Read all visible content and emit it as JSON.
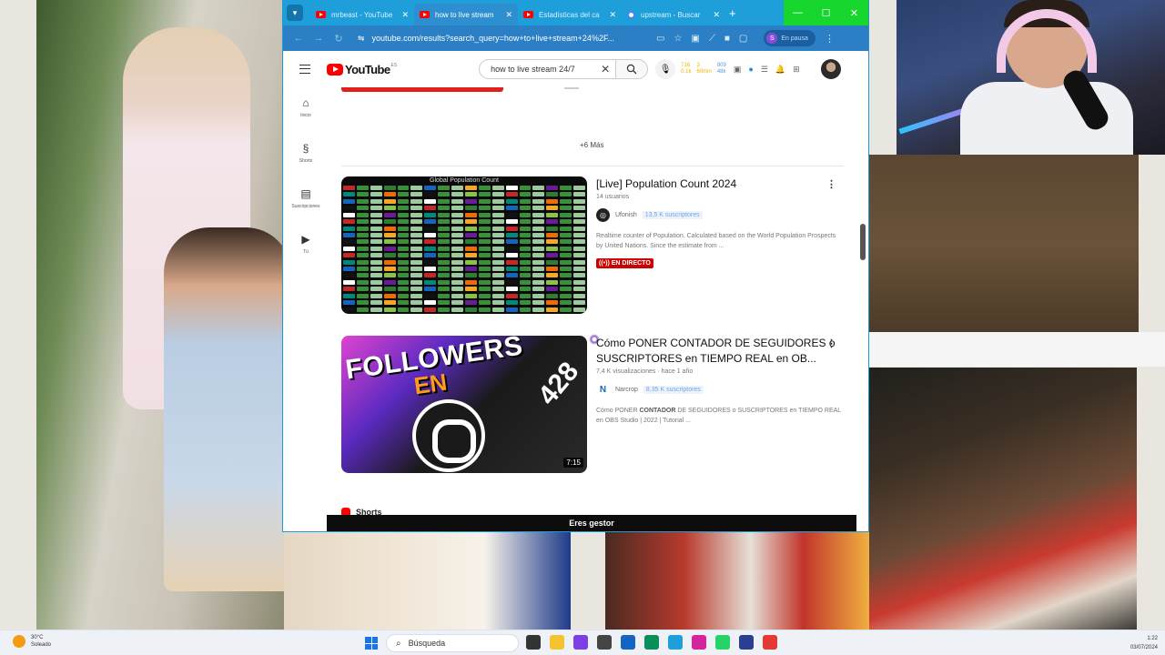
{
  "browser": {
    "tabs": [
      {
        "label": "mrbeast - YouTube",
        "icon": "youtube-icon",
        "active": false
      },
      {
        "label": "how to live stream",
        "icon": "youtube-icon",
        "active": true
      },
      {
        "label": "Estadísticas del ca",
        "icon": "youtube-icon",
        "active": false
      },
      {
        "label": "upstream - Buscar",
        "icon": "google-icon",
        "active": false
      }
    ],
    "url": "youtube.com/results?search_query=how+to+live+stream+24%2F...",
    "profile_initial": "S",
    "profile_label": "En pausa"
  },
  "youtube": {
    "logo_text": "YouTube",
    "logo_country": "ES",
    "search_value": "how to live stream 24/7",
    "stats": {
      "a_top": "716",
      "a_bottom": "0.1k",
      "b_top": "3",
      "b_bottom": "60min",
      "c_top": "809",
      "c_bottom": "48k"
    },
    "sidebar": [
      {
        "label": "Inicio",
        "icon": "home-icon"
      },
      {
        "label": "Shorts",
        "icon": "shorts-icon"
      },
      {
        "label": "Suscripciones",
        "icon": "subscriptions-icon"
      },
      {
        "label": "Tú",
        "icon": "you-icon"
      }
    ],
    "more_label": "+6 Más",
    "videos": [
      {
        "title": "[Live] Population Count 2024",
        "subline": "14 usuarios",
        "channel": "Ufonish",
        "subscribers": "13,5 K suscriptores",
        "description": "Realtime counter of Population. Calculated based on the World Population Prospects by United Nations. Since the estimate from ...",
        "badge": "EN DIRECTO",
        "thumb_title": "Global Population Count"
      },
      {
        "title": "Cómo PONER CONTADOR DE SEGUIDORES o SUSCRIPTORES en TIEMPO REAL en OB...",
        "subline": "7,4 K visualizaciones · hace 1 año",
        "channel": "Narcrop",
        "subscribers": "8,35 K suscriptores",
        "description_pre": "Cómo PONER ",
        "description_bold": "CONTADOR",
        "description_post": " DE SEGUIDORES o SUSCRIPTORES en TIEMPO REAL en OBS Studio | 2022 | Tutorial ...",
        "duration": "7:15",
        "thumb_big": "FOLLOWERS",
        "thumb_en": "EN",
        "thumb_num": "428"
      }
    ],
    "shorts_label": "Shorts",
    "manager_banner": "Eres gestor"
  },
  "taskbar": {
    "temperature": "30°C",
    "weather": "Soleado",
    "search_placeholder": "Búsqueda",
    "time": "1:22",
    "date": "03/07/2024"
  },
  "colors": {
    "browser_accent": "#1e9fd9",
    "youtube_red": "#ff0000",
    "live_red": "#cc0000"
  }
}
